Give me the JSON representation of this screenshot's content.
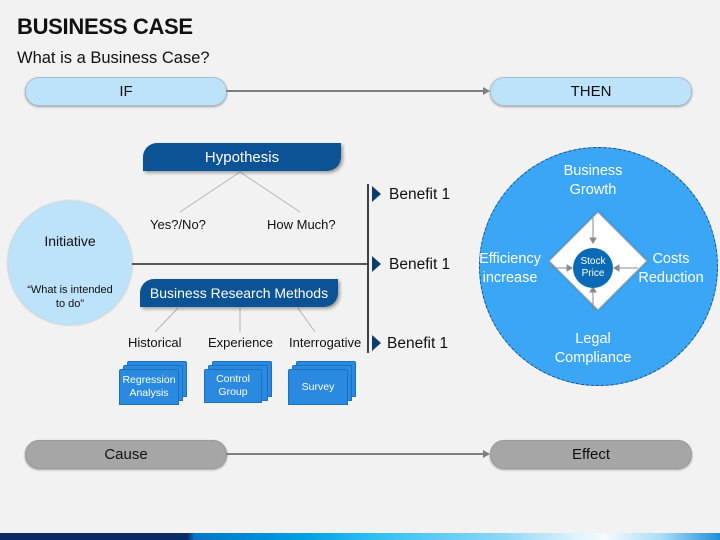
{
  "header": {
    "title": "BUSINESS CASE",
    "subtitle": "What is a Business Case?"
  },
  "if_then": {
    "left_label": "IF",
    "right_label": "THEN"
  },
  "hypothesis": {
    "title": "Hypothesis",
    "branches": [
      "Yes?/No?",
      "How Much?"
    ]
  },
  "initiative": {
    "title": "Initiative",
    "description": "“What is intended to do”"
  },
  "research": {
    "title": "Business Research Methods",
    "methods": [
      {
        "category": "Historical",
        "item": "Regression Analysis"
      },
      {
        "category": "Experience",
        "item": "Control Group"
      },
      {
        "category": "Interrogative",
        "item": "Survey"
      }
    ]
  },
  "benefits": [
    "Benefit 1",
    "Benefit 1",
    "Benefit 1"
  ],
  "outcome_circle": {
    "top": "Business Growth",
    "left": "Efficiency increase",
    "right": "Costs Reduction",
    "bottom": "Legal Compliance",
    "center": "Stock Price"
  },
  "cause_effect": {
    "left_label": "Cause",
    "right_label": "Effect"
  },
  "colors": {
    "banner": "#0b5394",
    "pill_light": "#bde3fb",
    "pill_gray": "#a6a6a6",
    "circle": "#3aa6f5",
    "center": "#0b6ab8"
  }
}
